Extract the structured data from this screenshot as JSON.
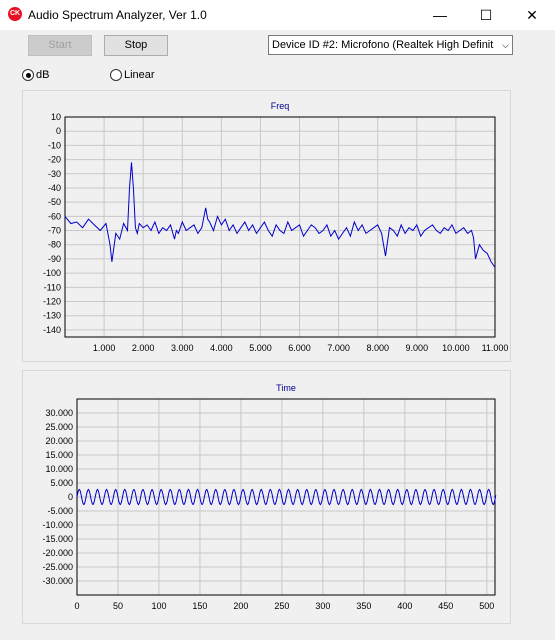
{
  "window": {
    "title": "Audio Spectrum Analyzer, Ver 1.0",
    "icon_text": "CK",
    "minimize_glyph": "—",
    "maximize_glyph": "☐",
    "close_glyph": "✕"
  },
  "toolbar": {
    "start_label": "Start",
    "stop_label": "Stop",
    "device_select": "Device ID #2: Microfono (Realtek High Definit",
    "dropdown_glyph": "⌵"
  },
  "mode": {
    "db_label": "dB",
    "linear_label": "Linear",
    "selected": "dB"
  },
  "colors": {
    "series": "#0000cc",
    "title": "#00008b",
    "grid": "#c8c8c8"
  },
  "chart_data": [
    {
      "type": "line",
      "title": "Freq",
      "xlabel": "",
      "ylabel": "",
      "xlim": [
        0,
        11000
      ],
      "ylim": [
        -145,
        10
      ],
      "x_ticks": [
        "1.000",
        "2.000",
        "3.000",
        "4.000",
        "5.000",
        "6.000",
        "7.000",
        "8.000",
        "9.000",
        "10.000",
        "11.000"
      ],
      "y_ticks": [
        "10",
        "0",
        "-10",
        "-20",
        "-30",
        "-40",
        "-50",
        "-60",
        "-70",
        "-80",
        "-90",
        "-100",
        "-110",
        "-120",
        "-130",
        "-140"
      ],
      "grid": true,
      "series": [
        {
          "x": [
            0,
            150,
            300,
            450,
            600,
            750,
            900,
            1050,
            1150,
            1200,
            1300,
            1400,
            1500,
            1600,
            1650,
            1700,
            1750,
            1800,
            1850,
            1900,
            2000,
            2100,
            2200,
            2300,
            2400,
            2500,
            2600,
            2700,
            2800,
            2850,
            2900,
            3000,
            3100,
            3200,
            3300,
            3400,
            3500,
            3600,
            3650,
            3700,
            3800,
            3900,
            4000,
            4100,
            4200,
            4300,
            4400,
            4500,
            4600,
            4700,
            4800,
            4900,
            5000,
            5100,
            5200,
            5300,
            5400,
            5500,
            5600,
            5700,
            5800,
            5900,
            6000,
            6100,
            6200,
            6300,
            6400,
            6500,
            6600,
            6700,
            6800,
            6900,
            7000,
            7100,
            7200,
            7300,
            7400,
            7500,
            7600,
            7700,
            7800,
            7900,
            8000,
            8100,
            8200,
            8300,
            8400,
            8500,
            8600,
            8700,
            8800,
            8900,
            9000,
            9100,
            9200,
            9300,
            9400,
            9500,
            9600,
            9700,
            9800,
            9900,
            10000,
            10100,
            10200,
            10300,
            10400,
            10450,
            10500,
            10600,
            10700,
            10800,
            10900,
            11000
          ],
          "y": [
            -60,
            -65,
            -64,
            -68,
            -62,
            -66,
            -70,
            -65,
            -80,
            -92,
            -72,
            -76,
            -65,
            -70,
            -40,
            -22,
            -40,
            -68,
            -72,
            -65,
            -68,
            -66,
            -70,
            -64,
            -72,
            -68,
            -70,
            -66,
            -76,
            -70,
            -72,
            -64,
            -70,
            -68,
            -66,
            -72,
            -68,
            -54,
            -62,
            -64,
            -70,
            -60,
            -66,
            -62,
            -70,
            -66,
            -72,
            -68,
            -64,
            -70,
            -66,
            -72,
            -68,
            -64,
            -70,
            -74,
            -66,
            -70,
            -72,
            -64,
            -70,
            -68,
            -66,
            -74,
            -70,
            -66,
            -68,
            -72,
            -70,
            -66,
            -74,
            -70,
            -76,
            -72,
            -68,
            -74,
            -64,
            -70,
            -66,
            -72,
            -70,
            -68,
            -66,
            -72,
            -88,
            -68,
            -70,
            -74,
            -66,
            -72,
            -68,
            -70,
            -66,
            -74,
            -70,
            -68,
            -66,
            -70,
            -72,
            -68,
            -70,
            -66,
            -72,
            -70,
            -68,
            -72,
            -70,
            -75,
            -90,
            -80,
            -84,
            -86,
            -92,
            -96
          ]
        }
      ]
    },
    {
      "type": "line",
      "title": "Time",
      "xlabel": "",
      "ylabel": "",
      "xlim": [
        0,
        510
      ],
      "ylim": [
        -35000,
        35000
      ],
      "x_ticks": [
        "0",
        "50",
        "100",
        "150",
        "200",
        "250",
        "300",
        "350",
        "400",
        "450",
        "500"
      ],
      "y_ticks": [
        "30.000",
        "25.000",
        "20.000",
        "15.000",
        "10.000",
        "5.000",
        "0",
        "-5.000",
        "-10.000",
        "-15.000",
        "-20.000",
        "-25.000",
        "-30.000"
      ],
      "grid": true,
      "series": [
        {
          "signal": "sinusoid",
          "amplitude": 2700,
          "period_samples": 11.1,
          "samples": 512
        }
      ]
    }
  ]
}
